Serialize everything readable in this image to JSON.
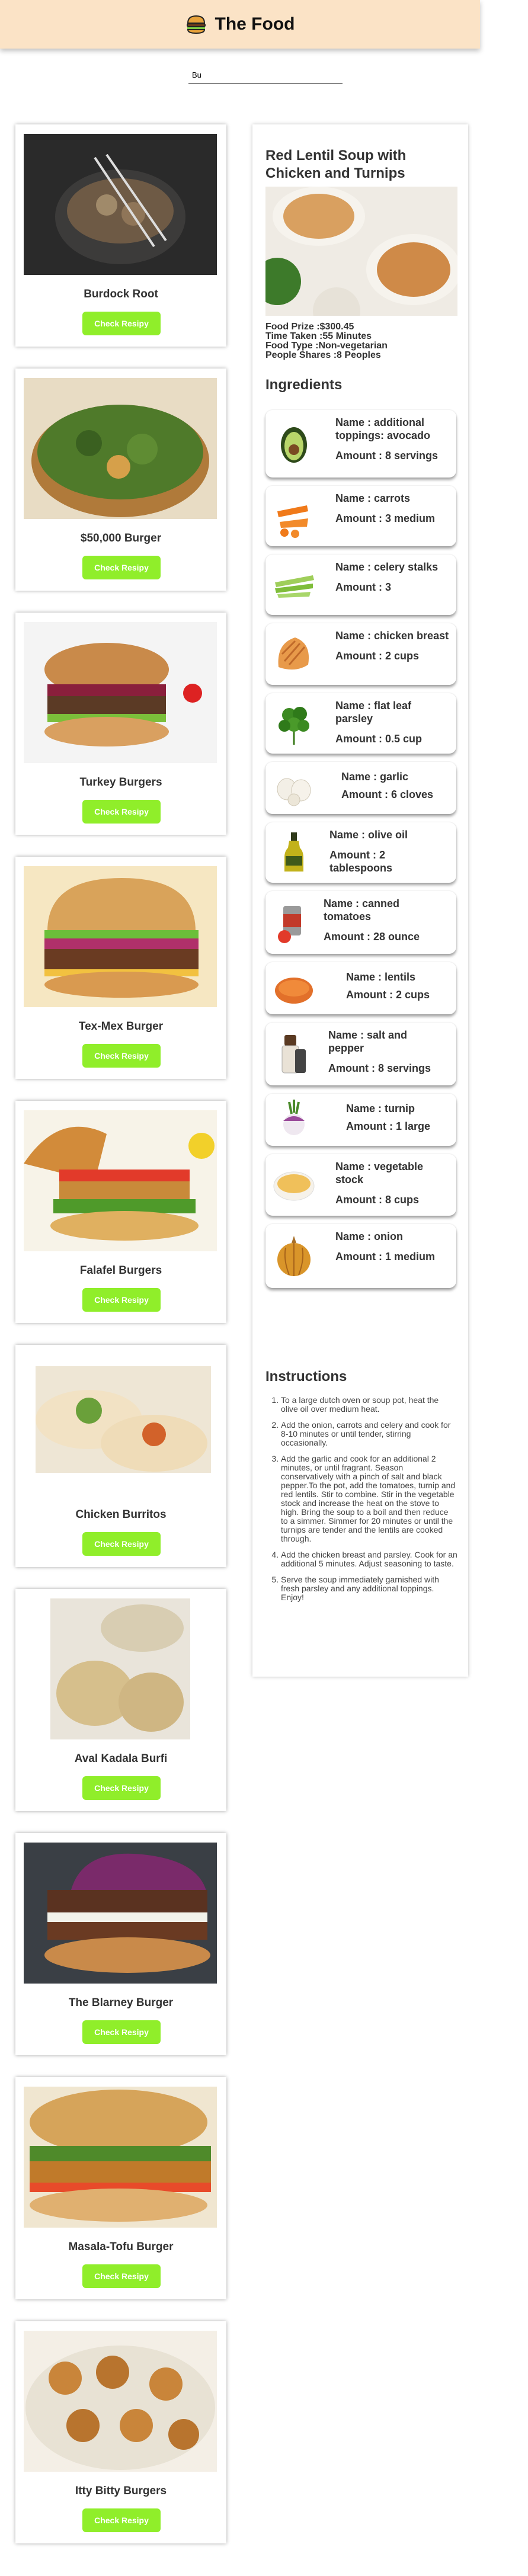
{
  "header": {
    "title": "The Food",
    "logo_icon": "burger-icon",
    "background": "#fbe3c6"
  },
  "search": {
    "value": "Bu",
    "placeholder": ""
  },
  "cards": [
    {
      "name": "Burdock Root",
      "button": "Check Resipy"
    },
    {
      "name": "$50,000 Burger",
      "button": "Check Resipy"
    },
    {
      "name": "Turkey Burgers",
      "button": "Check Resipy"
    },
    {
      "name": "Tex-Mex Burger",
      "button": "Check Resipy"
    },
    {
      "name": "Falafel Burgers",
      "button": "Check Resipy"
    },
    {
      "name": "Chicken Burritos",
      "button": "Check Resipy"
    },
    {
      "name": "Aval Kadala Burfi",
      "button": "Check Resipy"
    },
    {
      "name": "The Blarney Burger",
      "button": "Check Resipy"
    },
    {
      "name": "Masala-Tofu Burger",
      "button": "Check Resipy"
    },
    {
      "name": "Itty Bitty Burgers",
      "button": "Check Resipy"
    }
  ],
  "button_color": "#90ee2a",
  "recipe": {
    "title": "Red Lentil Soup with Chicken and Turnips",
    "price": "Food Prize :$300.45",
    "time": "Time Taken :55 Minutes",
    "type": "Food Type :Non-vegetarian",
    "shares": "People Shares :8 Peoples",
    "ingredients_heading": "Ingredients",
    "ingredients": [
      {
        "name": "Name : additional toppings: avocado",
        "amount": "Amount : 8 servings",
        "icon": "avocado-icon"
      },
      {
        "name": "Name : carrots",
        "amount": "Amount : 3 medium",
        "icon": "carrot-icon"
      },
      {
        "name": "Name : celery stalks",
        "amount": "Amount : 3",
        "icon": "celery-icon"
      },
      {
        "name": "Name : chicken breast",
        "amount": "Amount : 2 cups",
        "icon": "chicken-breast-icon"
      },
      {
        "name": "Name : flat leaf parsley",
        "amount": "Amount : 0.5 cup",
        "icon": "parsley-icon"
      },
      {
        "name": "Name : garlic",
        "amount": "Amount : 6 cloves",
        "icon": "garlic-icon"
      },
      {
        "name": "Name : olive oil",
        "amount": "Amount : 2 tablespoons",
        "icon": "olive-oil-icon"
      },
      {
        "name": "Name : canned tomatoes",
        "amount": "Amount : 28 ounce",
        "icon": "canned-tomato-icon"
      },
      {
        "name": "Name : lentils",
        "amount": "Amount : 2 cups",
        "icon": "lentils-icon"
      },
      {
        "name": "Name : salt and pepper",
        "amount": "Amount : 8 servings",
        "icon": "salt-pepper-icon"
      },
      {
        "name": "Name : turnip",
        "amount": "Amount : 1 large",
        "icon": "turnip-icon"
      },
      {
        "name": "Name : vegetable stock",
        "amount": "Amount : 8 cups",
        "icon": "vegetable-stock-icon"
      },
      {
        "name": "Name : onion",
        "amount": "Amount : 1 medium",
        "icon": "onion-icon"
      }
    ],
    "instructions_heading": "Instructions",
    "instructions": [
      "To a large dutch oven or soup pot, heat the olive oil over medium heat.",
      "Add the onion, carrots and celery and cook for 8-10 minutes or until tender, stirring occasionally.",
      "Add the garlic and cook for an additional 2 minutes, or until fragrant. Season conservatively with a pinch of salt and black pepper.To the pot, add the tomatoes, turnip and red lentils. Stir to combine. Stir in the vegetable stock and increase the heat on the stove to high. Bring the soup to a boil and then reduce to a simmer. Simmer for 20 minutes or until the turnips are tender and the lentils are cooked through.",
      "Add the chicken breast and parsley. Cook for an additional 5 minutes. Adjust seasoning to taste.",
      "Serve the soup immediately garnished with fresh parsley and any additional toppings. Enjoy!"
    ]
  }
}
